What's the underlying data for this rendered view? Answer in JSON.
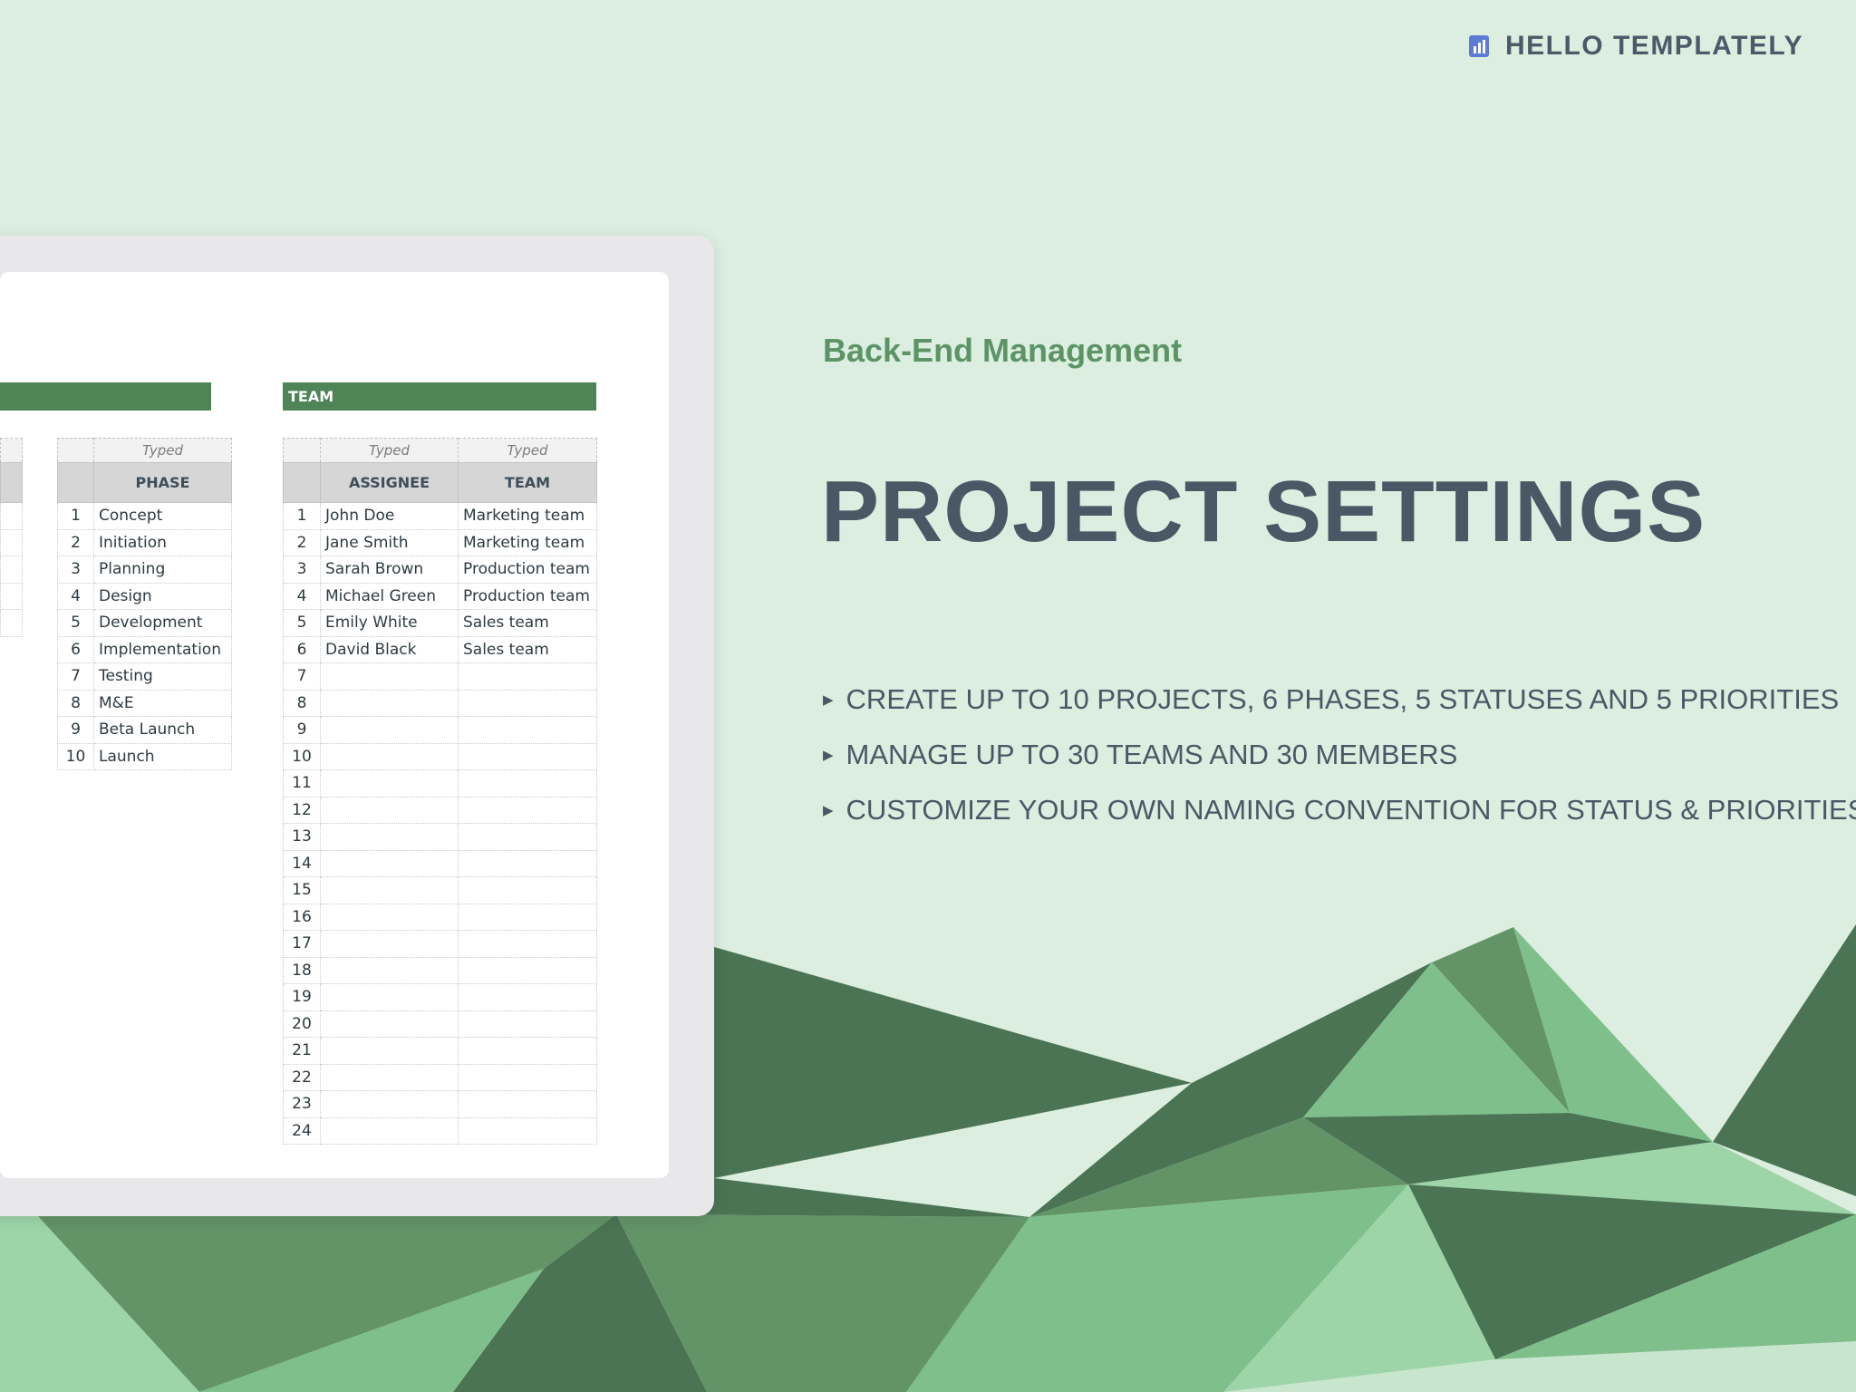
{
  "brand": {
    "name": "HELLO TEMPLATELY",
    "accent": "#5b7bd5"
  },
  "hero": {
    "subtitle": "Back-End Management",
    "title": "PROJECT SETTINGS",
    "bullets": [
      "CREATE UP TO 10 PROJECTS, 6 PHASES, 5 STATUSES AND 5 PRIORITIES",
      "MANAGE UP TO 30 TEAMS AND 30 MEMBERS",
      "CUSTOMIZE YOUR OWN NAMING CONVENTION FOR STATUS & PRIORITIES"
    ]
  },
  "colors": {
    "background": "#dbeee0",
    "section_bar": "#4f8457",
    "subtitle": "#5c9466",
    "text": "#4a5866"
  },
  "spreadsheet": {
    "phase_table": {
      "typed_label": "Typed",
      "header": "PHASE",
      "rows": [
        {
          "num": "1",
          "phase": "Concept"
        },
        {
          "num": "2",
          "phase": "Initiation"
        },
        {
          "num": "3",
          "phase": "Planning"
        },
        {
          "num": "4",
          "phase": "Design"
        },
        {
          "num": "5",
          "phase": "Development"
        },
        {
          "num": "6",
          "phase": "Implementation"
        },
        {
          "num": "7",
          "phase": "Testing"
        },
        {
          "num": "8",
          "phase": "M&E"
        },
        {
          "num": "9",
          "phase": "Beta Launch"
        },
        {
          "num": "10",
          "phase": "Launch"
        }
      ]
    },
    "team_table": {
      "section_title": "TEAM",
      "typed_assignee": "Typed",
      "typed_team": "Typed",
      "header_assignee": "ASSIGNEE",
      "header_team": "TEAM",
      "rows": [
        {
          "num": "1",
          "assignee": "John Doe",
          "team": "Marketing team"
        },
        {
          "num": "2",
          "assignee": "Jane Smith",
          "team": "Marketing team"
        },
        {
          "num": "3",
          "assignee": "Sarah Brown",
          "team": "Production team"
        },
        {
          "num": "4",
          "assignee": "Michael Green",
          "team": "Production team"
        },
        {
          "num": "5",
          "assignee": "Emily White",
          "team": "Sales team"
        },
        {
          "num": "6",
          "assignee": "David Black",
          "team": "Sales team"
        },
        {
          "num": "7",
          "assignee": "",
          "team": ""
        },
        {
          "num": "8",
          "assignee": "",
          "team": ""
        },
        {
          "num": "9",
          "assignee": "",
          "team": ""
        },
        {
          "num": "10",
          "assignee": "",
          "team": ""
        },
        {
          "num": "11",
          "assignee": "",
          "team": ""
        },
        {
          "num": "12",
          "assignee": "",
          "team": ""
        },
        {
          "num": "13",
          "assignee": "",
          "team": ""
        },
        {
          "num": "14",
          "assignee": "",
          "team": ""
        },
        {
          "num": "15",
          "assignee": "",
          "team": ""
        },
        {
          "num": "16",
          "assignee": "",
          "team": ""
        },
        {
          "num": "17",
          "assignee": "",
          "team": ""
        },
        {
          "num": "18",
          "assignee": "",
          "team": ""
        },
        {
          "num": "19",
          "assignee": "",
          "team": ""
        },
        {
          "num": "20",
          "assignee": "",
          "team": ""
        },
        {
          "num": "21",
          "assignee": "",
          "team": ""
        },
        {
          "num": "22",
          "assignee": "",
          "team": ""
        },
        {
          "num": "23",
          "assignee": "",
          "team": ""
        },
        {
          "num": "24",
          "assignee": "",
          "team": ""
        }
      ]
    }
  }
}
